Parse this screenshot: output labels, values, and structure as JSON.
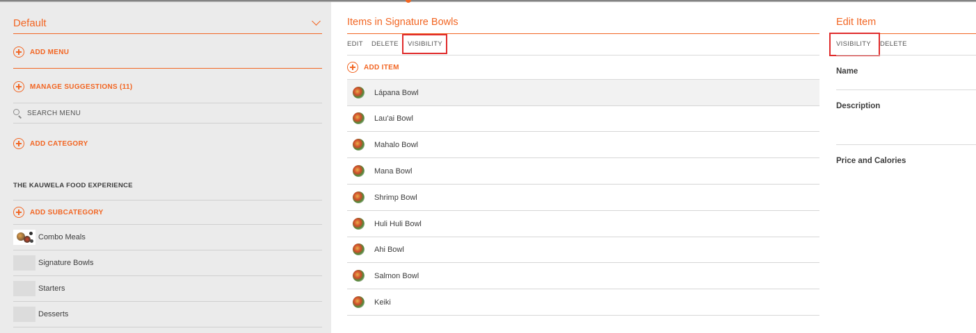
{
  "sidebar": {
    "menu_dropdown": "Default",
    "add_menu": "ADD MENU",
    "manage_suggestions": "MANAGE SUGGESTIONS (11)",
    "search_placeholder": "SEARCH MENU",
    "add_category": "ADD CATEGORY",
    "category_title": "THE KAUWELA FOOD EXPERIENCE",
    "add_subcategory": "ADD SUBCATEGORY",
    "subcategories": [
      {
        "label": "Combo Meals"
      },
      {
        "label": "Signature Bowls"
      },
      {
        "label": "Starters"
      },
      {
        "label": "Desserts"
      }
    ]
  },
  "items_panel": {
    "title": "Items in Signature Bowls",
    "toolbar": {
      "edit": "EDIT",
      "delete": "DELETE",
      "visibility": "VISIBILITY"
    },
    "add_item": "ADD ITEM",
    "items": [
      {
        "label": "Lápana Bowl"
      },
      {
        "label": "Lau'ai Bowl"
      },
      {
        "label": "Mahalo Bowl"
      },
      {
        "label": "Mana Bowl"
      },
      {
        "label": "Shrimp Bowl"
      },
      {
        "label": "Huli Huli Bowl"
      },
      {
        "label": "Ahi Bowl"
      },
      {
        "label": "Salmon Bowl"
      },
      {
        "label": "Keiki"
      }
    ]
  },
  "edit_panel": {
    "title": "Edit Item",
    "toolbar": {
      "visibility": "VISIBILITY",
      "delete": "DELETE"
    },
    "fields": {
      "name": "Name",
      "description": "Description",
      "price_calories": "Price and Calories"
    }
  },
  "colors": {
    "accent": "#f26522",
    "highlight": "#e02b2b",
    "sidebar_bg": "#ebebeb"
  }
}
